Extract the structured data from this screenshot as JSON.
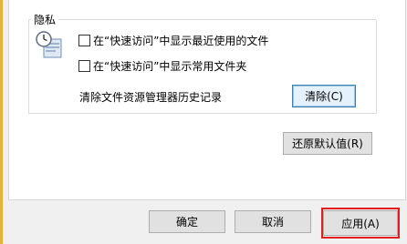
{
  "privacy": {
    "title": "隐私",
    "show_recent_files_label": "在“快速访问”中显示最近使用的文件",
    "show_frequent_folders_label": "在“快速访问”中显示常用文件夹",
    "clear_history_label": "清除文件资源管理器历史记录",
    "clear_button": "清除(C)"
  },
  "restore_defaults_button": "还原默认值(R)",
  "footer": {
    "ok_button": "确定",
    "cancel_button": "取消",
    "apply_button": "应用(A)"
  }
}
